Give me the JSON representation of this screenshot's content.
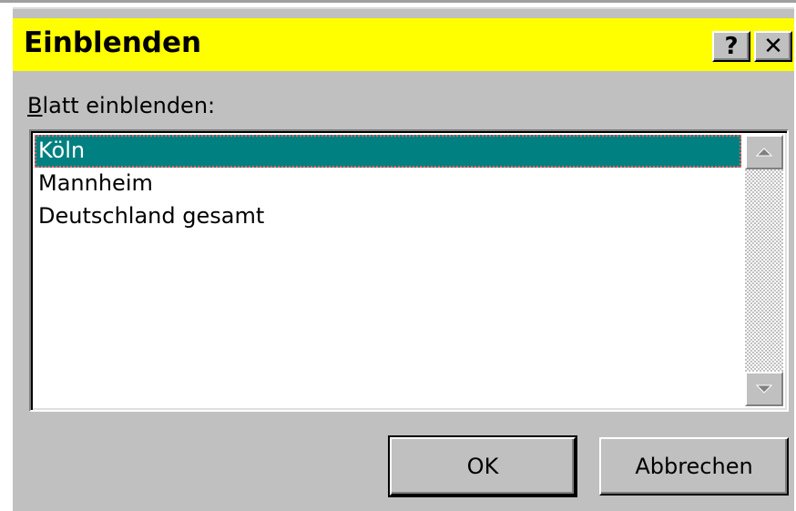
{
  "dialog": {
    "title": "Einblenden",
    "help_label": "?",
    "close_label": "✕"
  },
  "list": {
    "label_mnemonic": "B",
    "label_rest": "latt einblenden:",
    "items": [
      {
        "label": "Köln",
        "selected": true
      },
      {
        "label": "Mannheim",
        "selected": false
      },
      {
        "label": "Deutschland gesamt",
        "selected": false
      }
    ]
  },
  "buttons": {
    "ok_label": "OK",
    "cancel_label": "Abbrechen"
  },
  "colors": {
    "titlebar": "#ffff00",
    "selection": "#008080",
    "dialog_face": "#c0c0c0"
  },
  "icons": {
    "scroll_up": "triangle-up-icon",
    "scroll_down": "triangle-down-icon"
  }
}
